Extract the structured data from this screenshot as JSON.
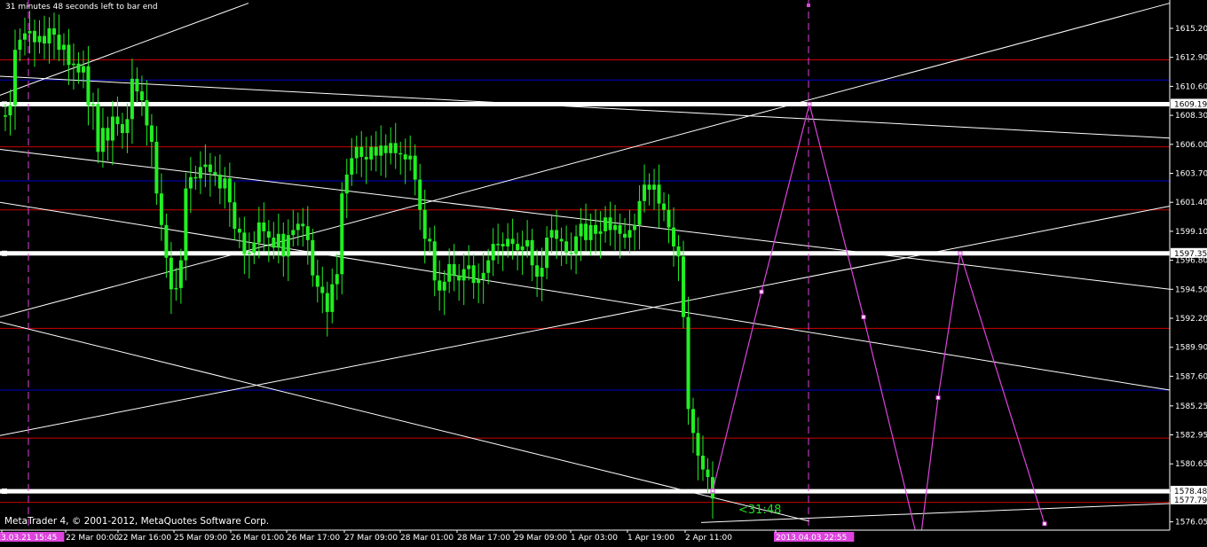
{
  "app": {
    "hud_text": "31 minutes 48 seconds left to bar end",
    "copyright": "MetaTrader 4, © 2001-2012, MetaQuotes Software Corp.",
    "countdown": "<31:48"
  },
  "colors": {
    "background": "#000000",
    "candle": "#22ee22",
    "red_level": "#cc0000",
    "blue_level": "#0000cc",
    "white_level": "#ffffff",
    "trendline": "#ffffff",
    "projection": "#dd44dd",
    "time_marker": "#dd44dd",
    "countdown": "#22dd22"
  },
  "chart_data": {
    "type": "line",
    "symbol_price_axis": "price",
    "ylim": [
      1576.01,
      1617.0
    ],
    "y_ticks": [
      "1615.20",
      "1612.90",
      "1610.60",
      "1608.30",
      "1606.00",
      "1603.70",
      "1601.40",
      "1599.10",
      "1596.80",
      "1594.50",
      "1592.20",
      "1589.90",
      "1587.60",
      "1585.25",
      "1582.95",
      "1580.65",
      "1578.35",
      "1576.05"
    ],
    "x_ticks": [
      "2013.03.21 15:45",
      "22 Mar 00:00",
      "22 Mar 16:00",
      "25 Mar 09:00",
      "26 Mar 01:00",
      "26 Mar 17:00",
      "27 Mar 09:00",
      "28 Mar 01:00",
      "28 Mar 17:00",
      "29 Mar 09:00",
      "1 Apr 03:00",
      "1 Apr 19:00",
      "2 Apr 11:00",
      "2013.04.03 22:55"
    ],
    "highlight_x_ticks": [
      "2013.03.21 15:45",
      "2013.04.03 22:55"
    ],
    "price_badges": [
      {
        "label": "1609.19",
        "value": 1609.19
      },
      {
        "label": "1597.35",
        "value": 1597.35
      },
      {
        "label": "1578.48",
        "value": 1578.48
      },
      {
        "label": "1577.79",
        "value": 1577.79
      }
    ],
    "horizontal_levels": {
      "red": [
        1612.7,
        1605.8,
        1600.8,
        1591.4,
        1582.7,
        1577.6
      ],
      "blue": [
        1611.1,
        1603.1,
        1586.5
      ],
      "white": [
        1609.19,
        1597.35,
        1578.48
      ]
    },
    "close_series": [
      1608.3,
      1609.1,
      1613.5,
      1614.3,
      1614.8,
      1615.0,
      1614.1,
      1614.6,
      1614.0,
      1615.2,
      1614.7,
      1613.5,
      1613.9,
      1612.3,
      1612.4,
      1611.7,
      1612.2,
      1609.1,
      1609.2,
      1605.4,
      1607.3,
      1606.3,
      1608.2,
      1607.6,
      1606.9,
      1608.0,
      1611.2,
      1610.2,
      1609.5,
      1607.5,
      1606.2,
      1602.1,
      1599.6,
      1597.0,
      1594.5,
      1594.6,
      1596.8,
      1602.5,
      1603.4,
      1603.3,
      1604.2,
      1604.4,
      1603.8,
      1603.6,
      1602.5,
      1603.3,
      1601.4,
      1599.3,
      1599.0,
      1597.3,
      1597.4,
      1598.2,
      1599.8,
      1599.1,
      1598.6,
      1597.8,
      1598.9,
      1597.1,
      1598.8,
      1599.2,
      1599.7,
      1599.5,
      1598.4,
      1595.6,
      1594.7,
      1594.2,
      1592.7,
      1594.9,
      1595.7,
      1602.1,
      1603.6,
      1604.9,
      1605.8,
      1605.0,
      1604.8,
      1605.8,
      1605.1,
      1605.9,
      1605.3,
      1606.1,
      1605.3,
      1605.2,
      1604.8,
      1605.1,
      1603.2,
      1600.8,
      1598.5,
      1598.3,
      1595.2,
      1594.4,
      1595.1,
      1596.5,
      1595.6,
      1595.2,
      1596.1,
      1596.4,
      1595.0,
      1595.3,
      1595.8,
      1596.8,
      1598.1,
      1598.1,
      1597.9,
      1598.5,
      1598.1,
      1597.6,
      1597.9,
      1598.4,
      1596.4,
      1595.5,
      1596.2,
      1598.6,
      1599.2,
      1598.5,
      1598.3,
      1597.4,
      1597.3,
      1598.7,
      1599.7,
      1598.4,
      1599.6,
      1598.9,
      1599.1,
      1600.2,
      1599.2,
      1599.6,
      1598.9,
      1598.6,
      1599.2,
      1599.6,
      1601.5,
      1602.8,
      1602.4,
      1602.8,
      1601.3,
      1600.8,
      1599.4,
      1597.9,
      1597.1,
      1592.3,
      1585.0,
      1583.1,
      1581.3,
      1580.2,
      1579.6,
      1577.9
    ],
    "trendlines": [
      {
        "from": [
          0,
          1609.9
        ],
        "to": [
          280,
          1617.2
        ]
      },
      {
        "from": [
          0,
          1611.4
        ],
        "to": [
          1318,
          1606.5
        ]
      },
      {
        "from": [
          0,
          1605.6
        ],
        "to": [
          1318,
          1594.5
        ]
      },
      {
        "from": [
          0,
          1601.4
        ],
        "to": [
          1318,
          1586.5
        ]
      },
      {
        "from": [
          0,
          1591.9
        ],
        "to": [
          912,
          1576.1
        ]
      },
      {
        "from": [
          0,
          1592.3
        ],
        "to": [
          1318,
          1617.2
        ]
      },
      {
        "from": [
          0,
          1582.9
        ],
        "to": [
          1318,
          1601.1
        ]
      },
      {
        "from": [
          790,
          1576.0
        ],
        "to": [
          1318,
          1577.5
        ]
      }
    ],
    "projection_points": [
      [
        803,
        1578.5
      ],
      [
        858,
        1594.3
      ],
      [
        912,
        1609.2
      ],
      [
        973,
        1592.3
      ],
      [
        1036,
        1574.0
      ],
      [
        1057,
        1585.9
      ],
      [
        1082,
        1597.35
      ],
      [
        1177,
        1575.9
      ]
    ],
    "time_markers": [
      {
        "label": "2013.03.21 15:45",
        "px": 32
      },
      {
        "label": "2013.04.03 22:55",
        "px": 911
      }
    ]
  }
}
